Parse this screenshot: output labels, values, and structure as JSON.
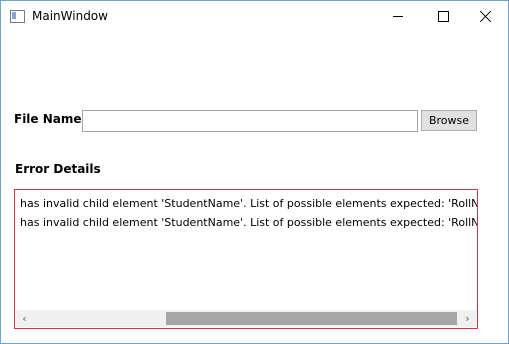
{
  "window": {
    "title": "MainWindow",
    "controls": {
      "minimize_icon": "minimize-icon",
      "maximize_icon": "maximize-icon",
      "close_icon": "close-icon"
    }
  },
  "form": {
    "file_label": "File Name :",
    "file_value": "",
    "browse_label": "Browse"
  },
  "errors": {
    "heading": "Error Details",
    "lines": [
      "has invalid child element 'StudentName'. List of possible elements expected: 'RollNo'.",
      "has invalid child element 'StudentName'. List of possible elements expected: 'RollNo'."
    ],
    "scroll_left_glyph": "‹",
    "scroll_right_glyph": "›",
    "scroll_position": 0.33
  },
  "colors": {
    "error_border": "#d9333f",
    "window_border": "#6f9fd8",
    "button_bg": "#e1e1e1"
  }
}
